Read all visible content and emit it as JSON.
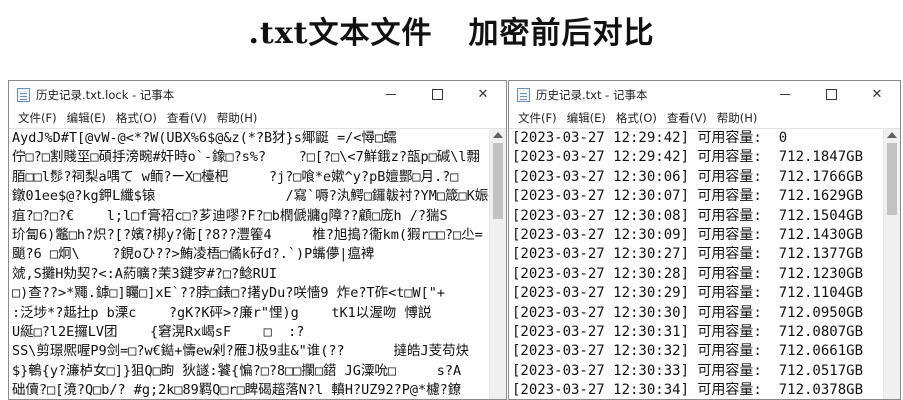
{
  "page_title": {
    "part1": ".txt文本文件",
    "part2": "加密前后对比"
  },
  "left_window": {
    "title": "历史记录.txt.lock - 记事本",
    "menu": [
      "文件(F)",
      "编辑(E)",
      "格式(O)",
      "查看(V)",
      "帮助(H)"
    ],
    "controls": {
      "minimize": "—",
      "maximize": "☐",
      "close": "✕"
    },
    "icon": "notepad-icon",
    "lines": [
      "AydJ%D#T[@vW-@<*?W(UBX%6$@&z(*?B犲}s鄊鼮 =/<憳□蠕",
      "佇□?□割賤坙□碩抙滂畹#奸時o`-鐌□?s%?    ?□[?□\\<7鮮鋨z?瓿p□碱\\l翲",
      "脜□□l髿?祠梨a喁て w鲕?ーX□檯杷     ?j?□喰*e嫰^y?pB嬗酆□月.?□",
      "鐓01ee$@?kg鉀L纖$锿                /寫`嗕?汍鰐□鑼韍衬?YM□箴□K娠<K,",
      "疽?□?□?€    l;l□f膏祒c□?芗迪嘐?F?□b橍傂牅g障??顧□庞h /?猯S",
      "玠匐6)鼈□h?炽?[?嬪?梆y?衛[?8??灃篧4     椎?旭搗?衞km(猳r□□?□尐=",
      "颵?6 □炯\\    ?鋧oひ??>鮪凌梧□僪k矷d?.`)P蟕儚|瘟裨               Q梾疊",
      "虠,S攤H劮契?<:A葯曠?茉3鍵穸#?□?鲶RUI",
      "□)查??>*鼆.鏬□]矚□]xE`??脖□錶□?擆yDu?咲懎9 炸e?T砟<t□W[\"+",
      ":泛埗*?趆扗p b溧c    ?gK?K砰>?廉r\"悝)g    tK1以渥吻 愽説",
      "U綖□?l2E攞LV团    {窘滉Rx嵑sF    □  :?",
      "SS\\剪璟熈喔P9剑=□?w€鐑+懤ew剁?雁J极9韭&\"谁(??      撻皓J芰苟炔",
      "$}鵪{y?濂栌女□]}狙Q□眗 狄譢:饕{惼?□?8□□攔□鍣 JG潥吮□     s?A",
      "础儥?□[滰?Q□b/? #g;2k□89羁Q□r□睥碣趦落N?l 轒H?UZ92?P@*櫖?鐐"
    ]
  },
  "right_window": {
    "title": "历史记录.txt - 记事本",
    "menu": [
      "文件(F)",
      "编辑(E)",
      "格式(O)",
      "查看(V)",
      "帮助(H)"
    ],
    "controls": {
      "minimize": "—",
      "maximize": "☐",
      "close": "✕"
    },
    "icon": "notepad-icon",
    "lines": [
      "[2023-03-27 12:29:42] 可用容量:  0",
      "[2023-03-27 12:29:42] 可用容量:  712.1847GB",
      "[2023-03-27 12:30:06] 可用容量:  712.1766GB",
      "[2023-03-27 12:30:07] 可用容量:  712.1629GB",
      "[2023-03-27 12:30:08] 可用容量:  712.1504GB",
      "[2023-03-27 12:30:09] 可用容量:  712.1430GB",
      "[2023-03-27 12:30:27] 可用容量:  712.1377GB",
      "[2023-03-27 12:30:28] 可用容量:  712.1230GB",
      "[2023-03-27 12:30:29] 可用容量:  712.1104GB",
      "[2023-03-27 12:30:30] 可用容量:  712.0950GB",
      "[2023-03-27 12:30:31] 可用容量:  712.0807GB",
      "[2023-03-27 12:30:32] 可用容量:  712.0661GB",
      "[2023-03-27 12:30:33] 可用容量:  712.0517GB",
      "[2023-03-27 12:30:34] 可用容量:  712.0378GB"
    ]
  }
}
